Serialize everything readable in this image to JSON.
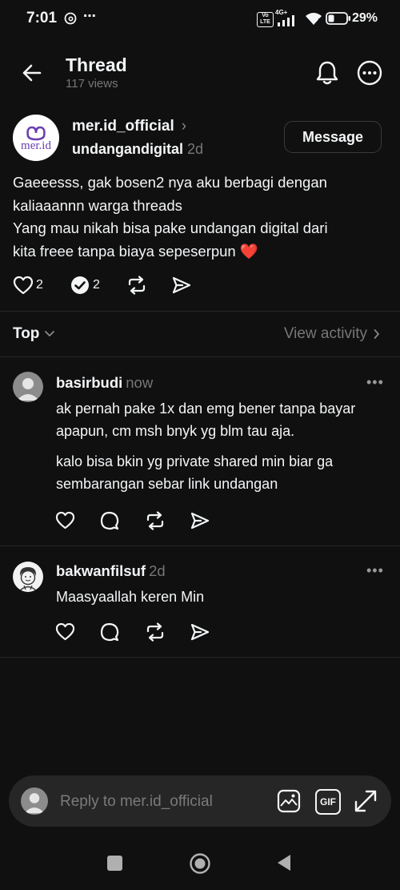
{
  "status_bar": {
    "time": "7:01",
    "network": "4G+",
    "volte": "Vo LTE",
    "battery": "29%"
  },
  "header": {
    "title": "Thread",
    "views": "117 views",
    "icons": [
      "back-arrow-icon",
      "bell-icon",
      "more-circle-icon"
    ]
  },
  "post": {
    "author": "mer.id_official",
    "logo_text": "mer.id",
    "tag": "undangandigital",
    "time": "2d",
    "message_button": "Message",
    "lines": [
      "Gaeeesss, gak bosen2 nya aku berbagi dengan",
      "kaliaaannn warga threads",
      "Yang mau nikah bisa pake undangan digital dari",
      "kita freee tanpa biaya sepeserpun ❤️"
    ],
    "likes": "2",
    "reposts": "2"
  },
  "sort": {
    "label": "Top",
    "view_activity": "View activity"
  },
  "replies": [
    {
      "user": "basirbudi",
      "time": "now",
      "paragraphs": [
        "ak pernah pake 1x dan emg bener tanpa bayar apapun, cm msh bnyk yg blm tau aja.",
        "kalo bisa bkin yg private shared min biar ga sembarangan sebar link undangan"
      ]
    },
    {
      "user": "bakwanfilsuf",
      "time": "2d",
      "paragraphs": [
        "Maasyaallah keren Min"
      ]
    }
  ],
  "composer": {
    "placeholder": "Reply to mer.id_official",
    "gif_label": "GIF"
  },
  "colors": {
    "background": "#101010",
    "text": "#f3f5f7",
    "muted": "#777777",
    "heart": "#e0323c"
  }
}
